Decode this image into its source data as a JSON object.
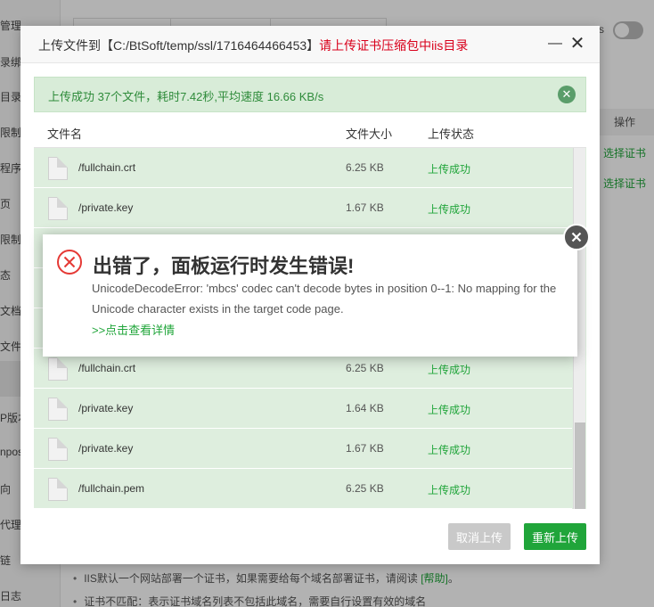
{
  "sidebar": {
    "items": [
      "管理",
      "录绑",
      "目录",
      "限制",
      "程序",
      "页",
      "限制",
      "态",
      "文档",
      "文件",
      "",
      "P版本",
      "npos",
      "向",
      "代理",
      "链",
      "日志"
    ]
  },
  "background": {
    "toggle_letter": "s",
    "table_header_action": "操作",
    "row_actions": [
      "选择证书",
      "选择证书"
    ],
    "notes": [
      {
        "text": "IIS默认一个网站部署一个证书，如果需要给每个域名部署证书，请阅读 ",
        "link": "[帮助]",
        "after": "。"
      },
      {
        "text": "证书不匹配：表示证书域名列表不包括此域名，需要自行设置有效的域名",
        "link": "",
        "after": ""
      }
    ]
  },
  "dialog": {
    "title_prefix": "上传文件到【C:/BtSoft/temp/ssl/1716464466453】",
    "title_hint": "请上传证书压缩包中iis目录",
    "min_icon": "minimize-icon",
    "close_icon": "close-icon",
    "success_message": "上传成功 37个文件，耗时7.42秒,平均速度 16.66 KB/s",
    "columns": {
      "name": "文件名",
      "size": "文件大小",
      "status": "上传状态"
    },
    "files": [
      {
        "name": "/fullchain.crt",
        "size": "6.25 KB",
        "status": "上传成功"
      },
      {
        "name": "/private.key",
        "size": "1.67 KB",
        "status": "上传成功"
      },
      {
        "name": "",
        "size": "",
        "status": ""
      },
      {
        "name": "",
        "size": "",
        "status": ""
      },
      {
        "name": "",
        "size": "",
        "status": ""
      },
      {
        "name": "/fullchain.crt",
        "size": "6.25 KB",
        "status": "上传成功"
      },
      {
        "name": "/private.key",
        "size": "1.64 KB",
        "status": "上传成功"
      },
      {
        "name": "/private.key",
        "size": "1.67 KB",
        "status": "上传成功"
      },
      {
        "name": "/fullchain.pem",
        "size": "6.25 KB",
        "status": "上传成功"
      }
    ],
    "cancel_label": "取消上传",
    "reupload_label": "重新上传"
  },
  "error": {
    "title": "出错了，面板运行时发生错误!",
    "message": "UnicodeDecodeError: 'mbcs' codec can't decode bytes in position 0--1: No mapping for the Unicode character exists in the target code page.",
    "link": ">>点击查看详情",
    "icon": "error-x-icon",
    "close_icon": "close-circle-icon"
  },
  "colors": {
    "accent_green": "#20a53a",
    "danger_red": "#d9001b",
    "success_bg": "#d8ecd8"
  }
}
